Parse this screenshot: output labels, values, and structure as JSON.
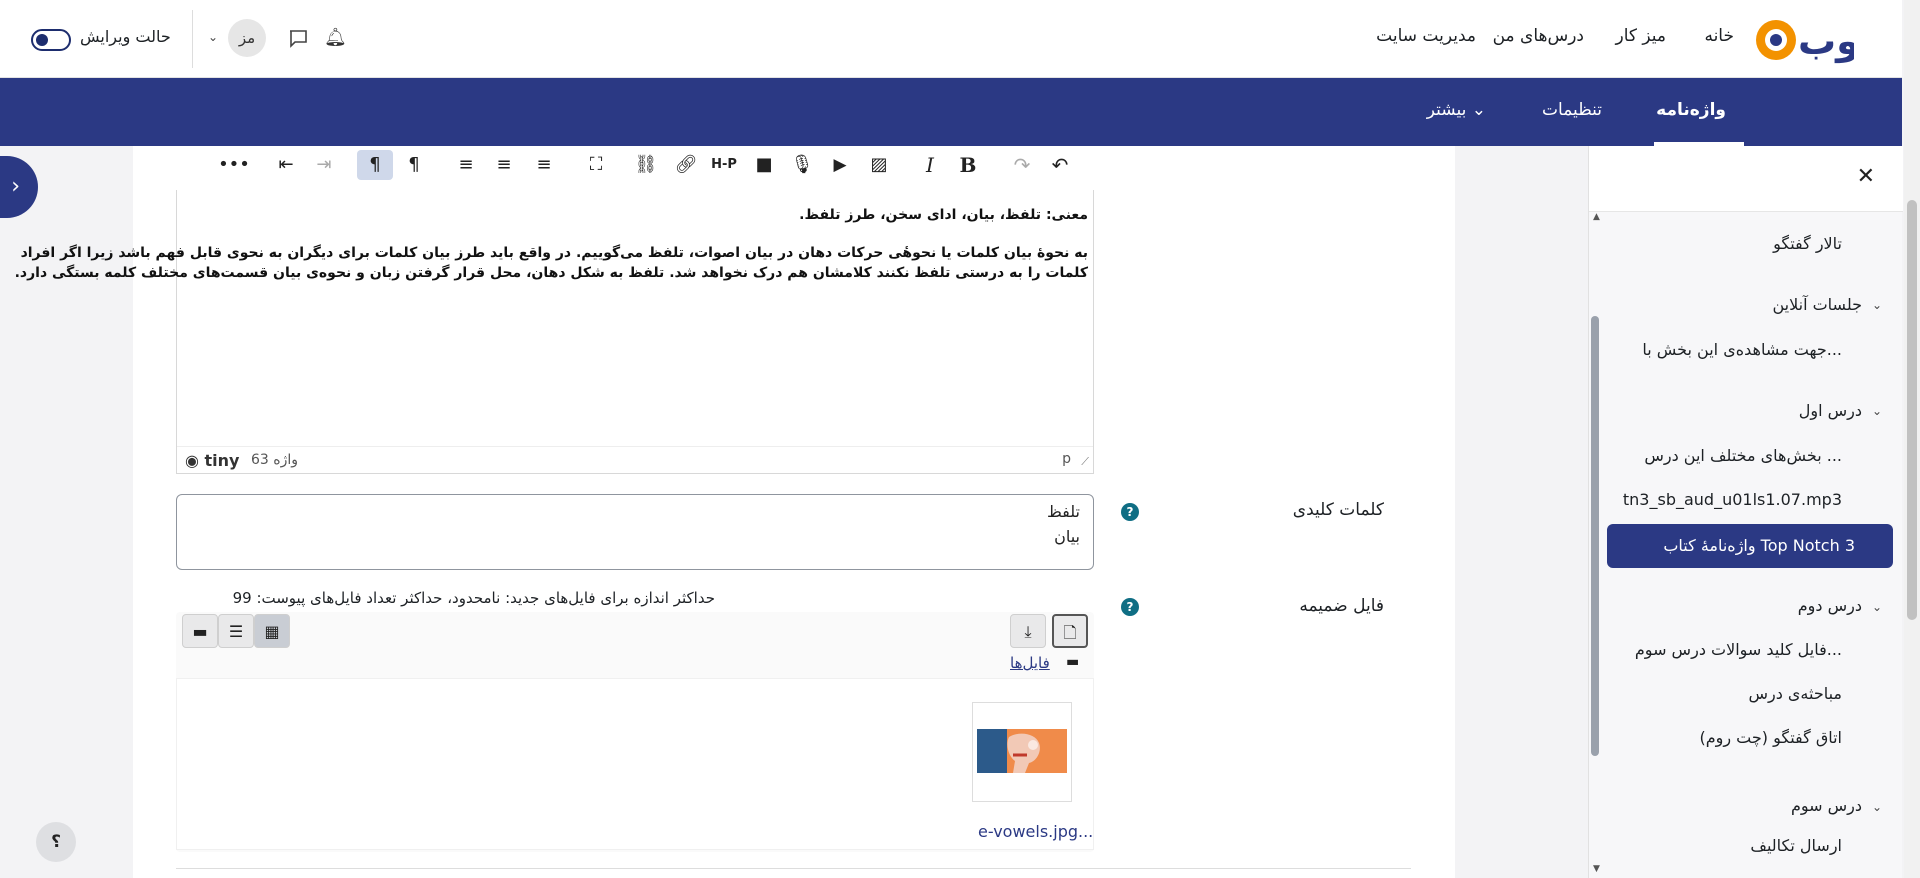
{
  "topbar": {
    "logo_text": "وب",
    "links": [
      "خانه",
      "میز کار",
      "درس‌های من",
      "مدیریت سایت"
    ],
    "edit_mode": "حالت ویرایش",
    "avatar_initials": "مز"
  },
  "secnav": {
    "items": [
      "واژه‌نامه",
      "تنظیمات",
      "بیشتر"
    ],
    "active": "واژه‌نامه"
  },
  "drawer": {
    "items": [
      {
        "label": "تالار گفتگو",
        "type": "item"
      },
      {
        "label": "جلسات آنلاین",
        "type": "section"
      },
      {
        "label": "جهت مشاهده‌ی این بخش با...",
        "type": "item"
      },
      {
        "label": "درس اول",
        "type": "section"
      },
      {
        "label": "بخش‌های مختلف این درس ...",
        "type": "item"
      },
      {
        "label": "tn3_sb_aud_u01ls1.07.mp3",
        "type": "item"
      },
      {
        "label": "واژه‌نامهٔ کتاب Top Notch 3",
        "type": "active"
      },
      {
        "label": "درس دوم",
        "type": "section"
      },
      {
        "label": "فایل کلید سوالات درس سوم...",
        "type": "item"
      },
      {
        "label": "مباحثه‌ی درس",
        "type": "item"
      },
      {
        "label": "اتاق گفتگو (چت روم)",
        "type": "item"
      },
      {
        "label": "درس سوم",
        "type": "section"
      },
      {
        "label": "ارسال تکالیف",
        "type": "item"
      }
    ]
  },
  "editor": {
    "line1": "معنی: تلفظ، بیان، ادای سخن، طرز تلفظ.",
    "line2": "به نحوهٔ بیان کلمات یا نحوهٔی حرکات دهان در بیان اصوات، تلفظ می‌گوییم. در واقع باید طرز بیان کلمات برای دیگران به نحوی قابل فهم باشد زیرا اگر افراد",
    "line3": "کلمات را به درستی تلفظ نکنند کلامشان هم درک نخواهد شد. تلفظ به شکل دهان، محل قرار گرفتن زبان و نحوه‌ی بیان قسمت‌های مختلف کلمه بستگی دارد.",
    "word_count": "63 واژه",
    "brand": "tiny",
    "path": "p"
  },
  "keywords": {
    "label": "کلمات کلیدی",
    "values": [
      "تلفظ",
      "بیان"
    ]
  },
  "attachment": {
    "label": "فایل ضمیمه",
    "limit": "حداکثر اندازه برای فایل‌های جدید: نامحدود، حداکثر تعداد فایل‌های پیوست: 99",
    "folder_link": "فایل‌ها",
    "file_name": "e-vowels.jpg..."
  },
  "help_button": "؟"
}
